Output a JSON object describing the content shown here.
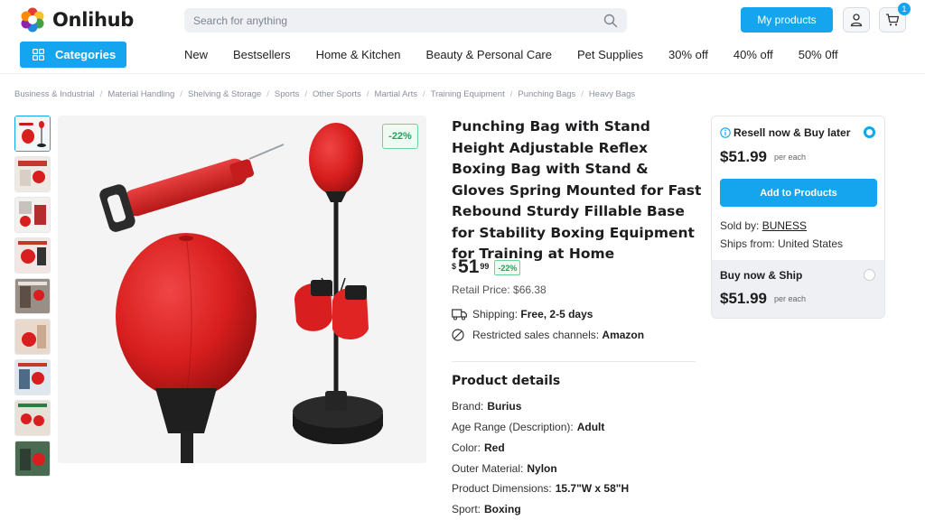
{
  "header": {
    "logo_text": "Onlihub",
    "search_placeholder": "Search for anything",
    "my_products_label": "My products",
    "cart_count": "1"
  },
  "nav": {
    "categories_label": "Categories",
    "links": [
      "New",
      "Bestsellers",
      "Home & Kitchen",
      "Beauty & Personal Care",
      "Pet Supplies",
      "30% off",
      "40% off",
      "50% 0ff"
    ]
  },
  "breadcrumb": [
    "Business & Industrial",
    "Material Handling",
    "Shelving & Storage",
    "Sports",
    "Other Sports",
    "Martial Arts",
    "Training Equipment",
    "Punching Bags",
    "Heavy Bags"
  ],
  "product": {
    "image_discount_badge": "-22%",
    "title": "Punching Bag with Stand Height Adjustable Reflex Boxing Bag with Stand & Gloves Spring Mounted for Fast Rebound Sturdy Fillable Base for Stability Boxing Equipment for Training at Home",
    "price_currency": "$",
    "price_main": "51",
    "price_cents": "99",
    "price_discount": "-22%",
    "retail_price": "Retail Price: $66.38",
    "shipping_label": "Shipping:",
    "shipping_value": "Free, 2-5 days",
    "restricted_label": "Restricted sales channels:",
    "restricted_value": "Amazon"
  },
  "details": {
    "title": "Product details",
    "rows": [
      {
        "label": "Brand:",
        "value": "Burius"
      },
      {
        "label": "Age Range (Description):",
        "value": "Adult"
      },
      {
        "label": "Color:",
        "value": "Red"
      },
      {
        "label": "Outer Material:",
        "value": "Nylon"
      },
      {
        "label": "Product Dimensions:",
        "value": "15.7\"W x 58\"H"
      },
      {
        "label": "Sport:",
        "value": "Boxing"
      }
    ]
  },
  "purchase": {
    "resell_title": "Resell now & Buy later",
    "resell_price": "$51.99",
    "per_each": "per each",
    "add_button": "Add to Products",
    "sold_by_label": "Sold by:",
    "sold_by_value": "BUNESS",
    "ships_from": "Ships from: United States",
    "buy_title": "Buy now & Ship",
    "buy_price": "$51.99"
  },
  "colors": {
    "accent": "#14a5ee",
    "discount_green": "#21a35b",
    "product_red": "#d81e1e"
  }
}
